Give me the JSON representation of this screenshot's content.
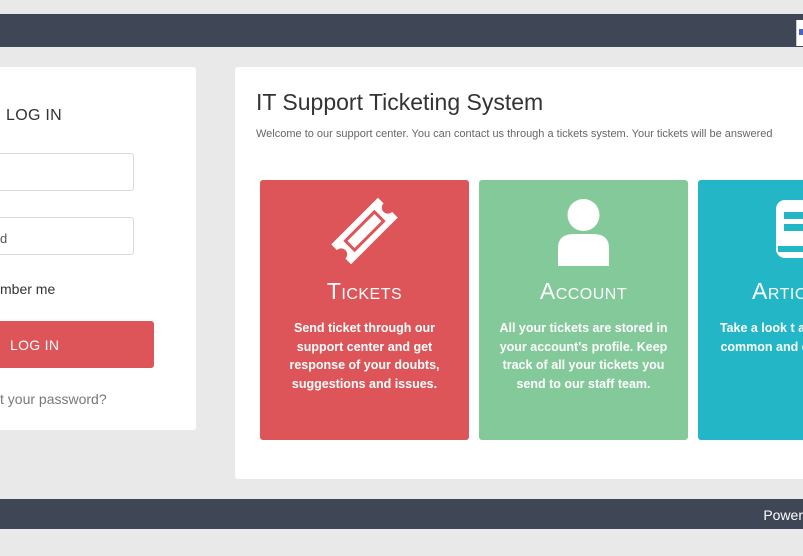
{
  "login": {
    "title": "LOG IN",
    "password_text": "d",
    "remember_label": "mber me",
    "button_label": "LOG IN",
    "forgot_label": "t your password?"
  },
  "main": {
    "title": "IT Support Ticketing System",
    "welcome": "Welcome to our support center. You can contact us through a tickets system. Your tickets will be answered"
  },
  "cards": [
    {
      "title": "Tickets",
      "icon": "ticket-icon",
      "color": "#dd5558",
      "desc": "Send ticket through our support center and get response of your doubts, suggestions and issues."
    },
    {
      "title": "Account",
      "icon": "user-icon",
      "color": "#83c99a",
      "desc": "All your tickets are stored in your account's profile. Keep track of all your tickets you send to our staff team."
    },
    {
      "title": "Artic",
      "icon": "book-icon",
      "color": "#23b6c7",
      "desc": "Take a look t about common and docu"
    }
  ],
  "footer": {
    "text": "Power"
  },
  "colors": {
    "topbar": "#3f4757",
    "accent_red": "#dd5558",
    "accent_green": "#83c99a",
    "accent_teal": "#23b6c7"
  }
}
